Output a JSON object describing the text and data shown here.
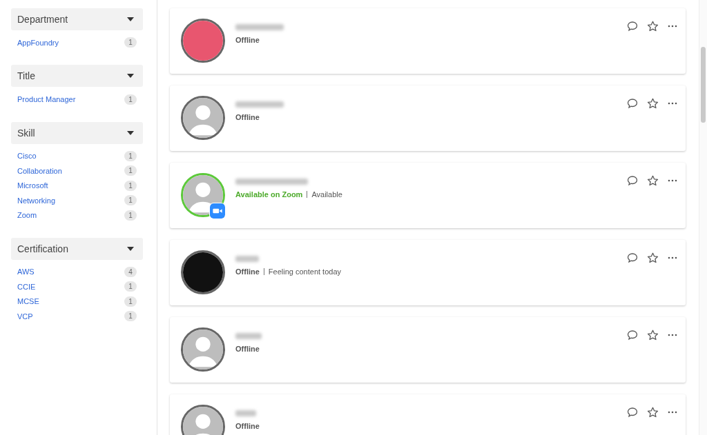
{
  "filters": [
    {
      "title": "Department",
      "expanded": true,
      "items": [
        {
          "label": "AppFoundry",
          "count": "1"
        }
      ]
    },
    {
      "title": "Title",
      "expanded": true,
      "items": [
        {
          "label": "Product Manager",
          "count": "1"
        }
      ]
    },
    {
      "title": "Skill",
      "expanded": true,
      "items": [
        {
          "label": "Cisco",
          "count": "1"
        },
        {
          "label": "Collaboration",
          "count": "1"
        },
        {
          "label": "Microsoft",
          "count": "1"
        },
        {
          "label": "Networking",
          "count": "1"
        },
        {
          "label": "Zoom",
          "count": "1"
        }
      ]
    },
    {
      "title": "Certification",
      "expanded": true,
      "items": [
        {
          "label": "AWS",
          "count": "4"
        },
        {
          "label": "CCIE",
          "count": "1"
        },
        {
          "label": "MCSE",
          "count": "1"
        },
        {
          "label": "VCP",
          "count": "1"
        }
      ]
    }
  ],
  "people": [
    {
      "avatar": {
        "kind": "photo",
        "color": "#e8566f"
      },
      "kind": "offline",
      "zoom_badge": false,
      "status": "Offline"
    },
    {
      "avatar": {
        "kind": "default"
      },
      "kind": "offline",
      "zoom_badge": false,
      "status": "Offline"
    },
    {
      "avatar": {
        "kind": "default"
      },
      "kind": "available",
      "zoom_badge": true,
      "status": "Available on Zoom",
      "message": "Available"
    },
    {
      "avatar": {
        "kind": "photo",
        "color": "#111111"
      },
      "kind": "offline",
      "zoom_badge": false,
      "status": "Offline",
      "message": "Feeling content today"
    },
    {
      "avatar": {
        "kind": "default"
      },
      "kind": "offline",
      "zoom_badge": false,
      "status": "Offline"
    },
    {
      "avatar": {
        "kind": "default"
      },
      "kind": "offline",
      "zoom_badge": false,
      "status": "Offline"
    }
  ]
}
